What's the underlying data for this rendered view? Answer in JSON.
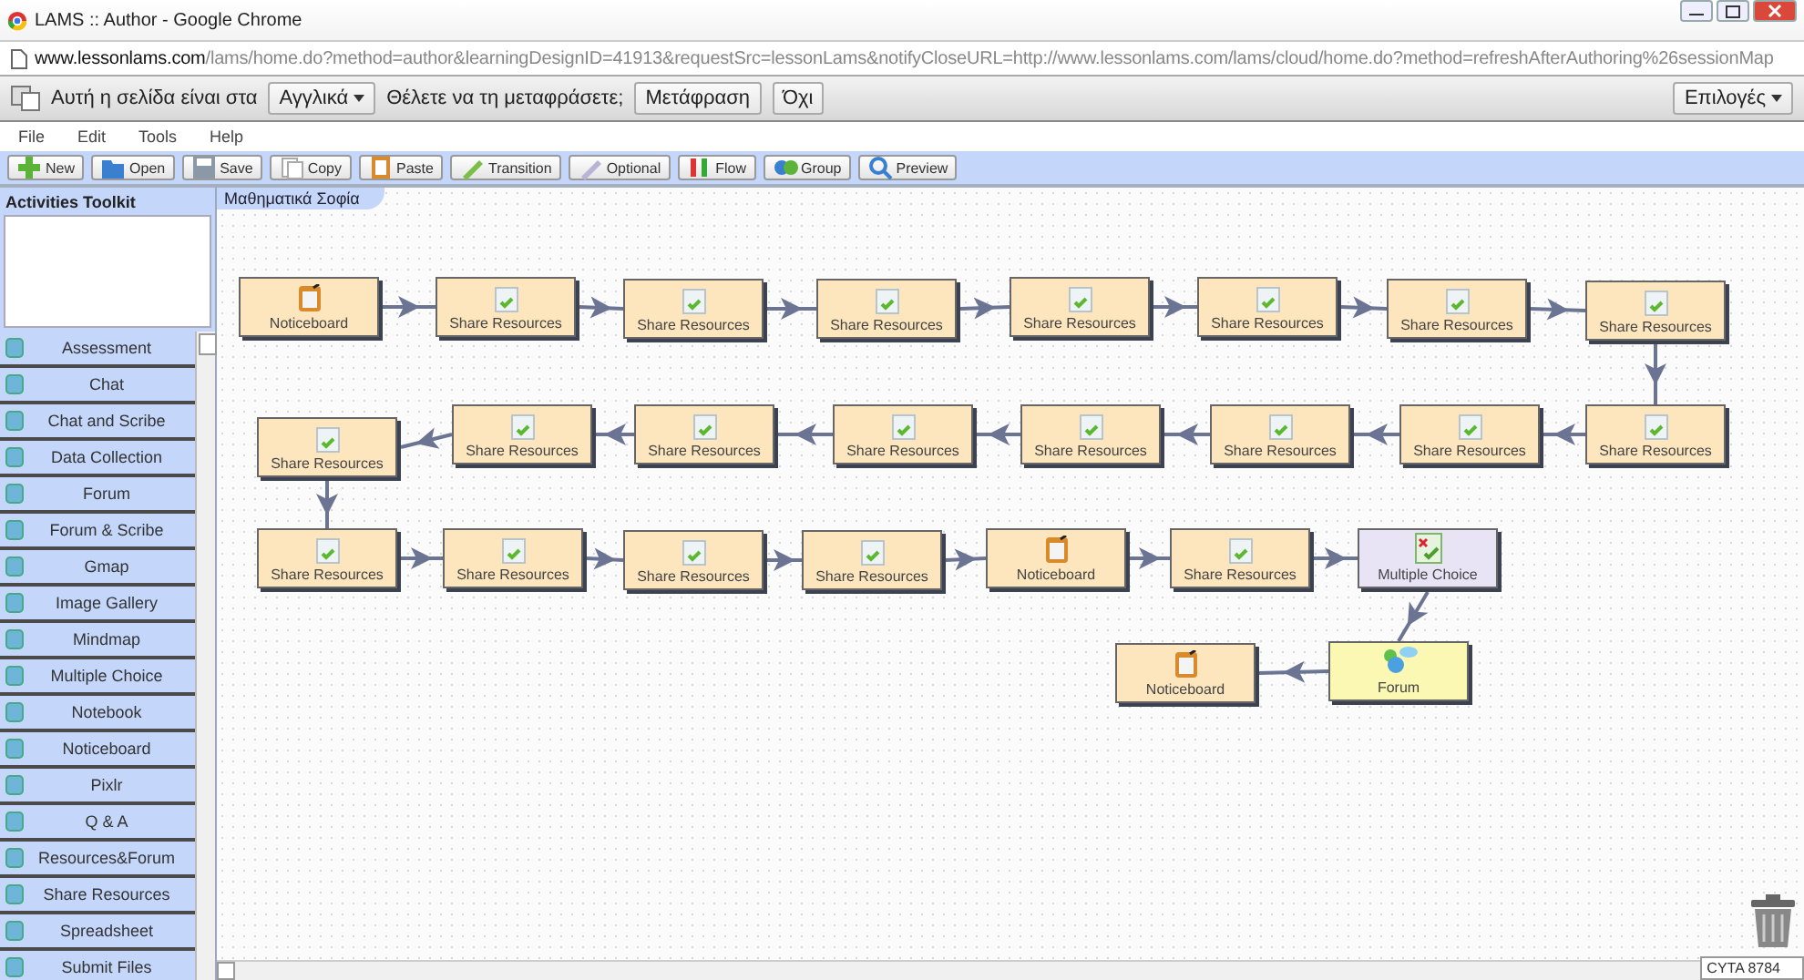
{
  "window": {
    "title": "LAMS :: Author - Google Chrome"
  },
  "address_bar": {
    "host": "www.lessonlams.com",
    "path": "/lams/home.do?method=author&learningDesignID=41913&requestSrc=lessonLams&notifyCloseURL=http://www.lessonlams.com/lams/cloud/home.do?method=refreshAfterAuthoring%26sessionMap"
  },
  "translate_bar": {
    "prefix": "Αυτή η σελίδα είναι στα",
    "language": "Αγγλικά",
    "question": "Θέλετε να τη μεταφράσετε;",
    "translate_button": "Μετάφραση",
    "no_button": "Όχι",
    "options_button": "Επιλογές"
  },
  "menu": [
    "File",
    "Edit",
    "Tools",
    "Help"
  ],
  "toolbar": [
    {
      "kind": "new",
      "label": "New"
    },
    {
      "kind": "open",
      "label": "Open"
    },
    {
      "kind": "save",
      "label": "Save"
    },
    {
      "kind": "copy",
      "label": "Copy"
    },
    {
      "kind": "paste",
      "label": "Paste"
    },
    {
      "kind": "transition",
      "label": "Transition"
    },
    {
      "kind": "optional",
      "label": "Optional"
    },
    {
      "kind": "flow",
      "label": "Flow"
    },
    {
      "kind": "group",
      "label": "Group"
    },
    {
      "kind": "preview",
      "label": "Preview"
    }
  ],
  "sidebar": {
    "title": "Activities Toolkit",
    "items": [
      "Assessment",
      "Chat",
      "Chat and Scribe",
      "Data Collection",
      "Forum",
      "Forum & Scribe",
      "Gmap",
      "Image Gallery",
      "Mindmap",
      "Multiple Choice",
      "Notebook",
      "Noticeboard",
      "Pixlr",
      "Q & A",
      "Resources&Forum",
      "Share Resources",
      "Spreadsheet",
      "Submit Files"
    ]
  },
  "canvas": {
    "tab": "Μαθηματικά Σοφία",
    "status": "CYTA 8784",
    "nodes": [
      {
        "kind": "noticeboard",
        "label": "Noticeboard"
      },
      {
        "kind": "share",
        "label": "Share Resources"
      },
      {
        "kind": "share",
        "label": "Share Resources"
      },
      {
        "kind": "share",
        "label": "Share Resources"
      },
      {
        "kind": "share",
        "label": "Share Resources"
      },
      {
        "kind": "share",
        "label": "Share Resources"
      },
      {
        "kind": "share",
        "label": "Share Resources"
      },
      {
        "kind": "share",
        "label": "Share Resources"
      },
      {
        "kind": "share",
        "label": "Share Resources"
      },
      {
        "kind": "share",
        "label": "Share Resources"
      },
      {
        "kind": "share",
        "label": "Share Resources"
      },
      {
        "kind": "share",
        "label": "Share Resources"
      },
      {
        "kind": "share",
        "label": "Share Resources"
      },
      {
        "kind": "share",
        "label": "Share Resources"
      },
      {
        "kind": "share",
        "label": "Share Resources"
      },
      {
        "kind": "share",
        "label": "Share Resources"
      },
      {
        "kind": "share",
        "label": "Share Resources"
      },
      {
        "kind": "share",
        "label": "Share Resources"
      },
      {
        "kind": "share",
        "label": "Share Resources"
      },
      {
        "kind": "share",
        "label": "Share Resources"
      },
      {
        "kind": "noticeboard",
        "label": "Noticeboard"
      },
      {
        "kind": "share",
        "label": "Share Resources"
      },
      {
        "kind": "multiple_choice",
        "label": "Multiple Choice"
      },
      {
        "kind": "noticeboard",
        "label": "Noticeboard"
      },
      {
        "kind": "forum",
        "label": "Forum"
      }
    ]
  }
}
